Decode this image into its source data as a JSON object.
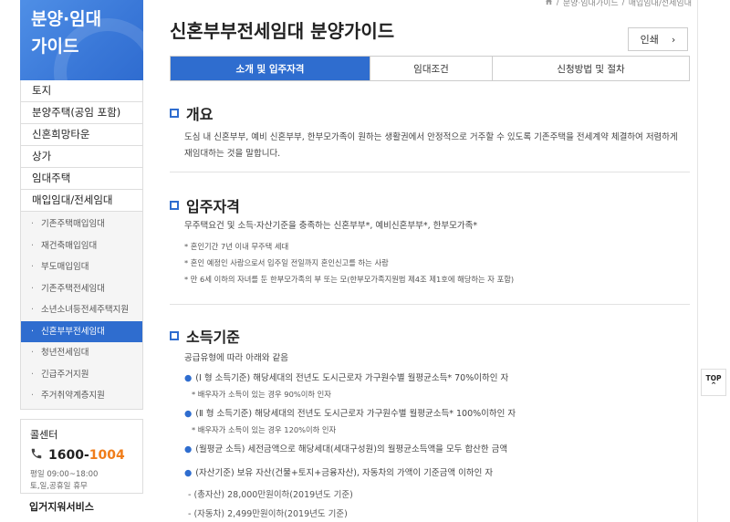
{
  "sidebar": {
    "heading_line1": "분양·임대",
    "heading_line2": "가이드",
    "menu": [
      "토지",
      "분양주택(공임 포함)",
      "신혼희망타운",
      "상가",
      "임대주택",
      "매입임대/전세임대"
    ],
    "submenu": [
      {
        "label": "기존주택매입임대",
        "active": false
      },
      {
        "label": "재건축매입임대",
        "active": false
      },
      {
        "label": "부도매입임대",
        "active": false
      },
      {
        "label": "기존주택전세임대",
        "active": false
      },
      {
        "label": "소년소녀등전세주택지원",
        "active": false
      },
      {
        "label": "신혼부부전세임대",
        "active": true
      },
      {
        "label": "청년전세임대",
        "active": false
      },
      {
        "label": "긴급주거지원",
        "active": false
      },
      {
        "label": "주거취약계층지원",
        "active": false
      }
    ],
    "callcenter": {
      "title": "콜센터",
      "phone_prefix": "1600-",
      "phone_suffix": "1004",
      "hours_line1": "평일 09:00~18:00",
      "hours_line2": "토,일,공휴일 휴무"
    },
    "bottom_label": "입거지워서비스"
  },
  "breadcrumb": [
    "분양·임대가이드",
    "매입임대/전세임대"
  ],
  "page_title": "신혼부부전세임대 분양가이드",
  "print_label": "인쇄",
  "tabs": [
    {
      "label": "소개 및 입주자격",
      "active": true
    },
    {
      "label": "임대조건",
      "active": false
    },
    {
      "label": "신청방법 및 절차",
      "active": false
    }
  ],
  "overview": {
    "title": "개요",
    "text": "도심 내 신혼부부, 예비 신혼부부, 한부모가족이 원하는 생활권에서 안정적으로 거주할 수 있도록 기존주택을 전세계약 체결하여 저렴하게 재임대하는 것을 말합니다."
  },
  "eligibility": {
    "title": "입주자격",
    "intro": "무주택요건 및 소득·자산기준을 충족하는 신혼부부*, 예비신혼부부*, 한부모가족*",
    "bullets": [
      "* 혼인기간 7년 이내 무주택 세대",
      "* 혼인 예정인 사람으로서 입주일 전일까지 혼인신고를 하는 사람",
      "* 만 6세 이하의 자녀를 둔 한부모가족의 부 또는 모(한부모가족지원법 제4조 제1호에 해당하는 자 포함)"
    ]
  },
  "income": {
    "title": "소득기준",
    "intro": "공급유형에 따라 아래와 같음",
    "items": [
      {
        "text": "(Ⅰ 형 소득기준) 해당세대의 전년도 도시근로자 가구원수별 월평균소득* 70%이하인 자",
        "note": "* 배우자가 소득이 있는 경우 90%이하 인자"
      },
      {
        "text": "(Ⅱ 형 소득기준) 해당세대의 전년도 도시근로자 가구원수별 월평균소득* 100%이하인 자",
        "note": "* 배우자가 소득이 있는 경우 120%이하 인자"
      },
      {
        "text": "(월평균 소득) 세전금액으로 해당세대(세대구성원)의 월평균소득액을 모두 합산한 금액",
        "note": ""
      },
      {
        "text": "(자산기준) 보유 자산(건물+토지+금융자산), 자동차의 가액이 기준금액 이하인 자",
        "note": ""
      }
    ],
    "sub_items": [
      "- (총자산) 28,000만원이하(2019년도 기준)",
      "- (자동차) 2,499만원이하(2019년도 기준)"
    ]
  },
  "top_label": "TOP"
}
